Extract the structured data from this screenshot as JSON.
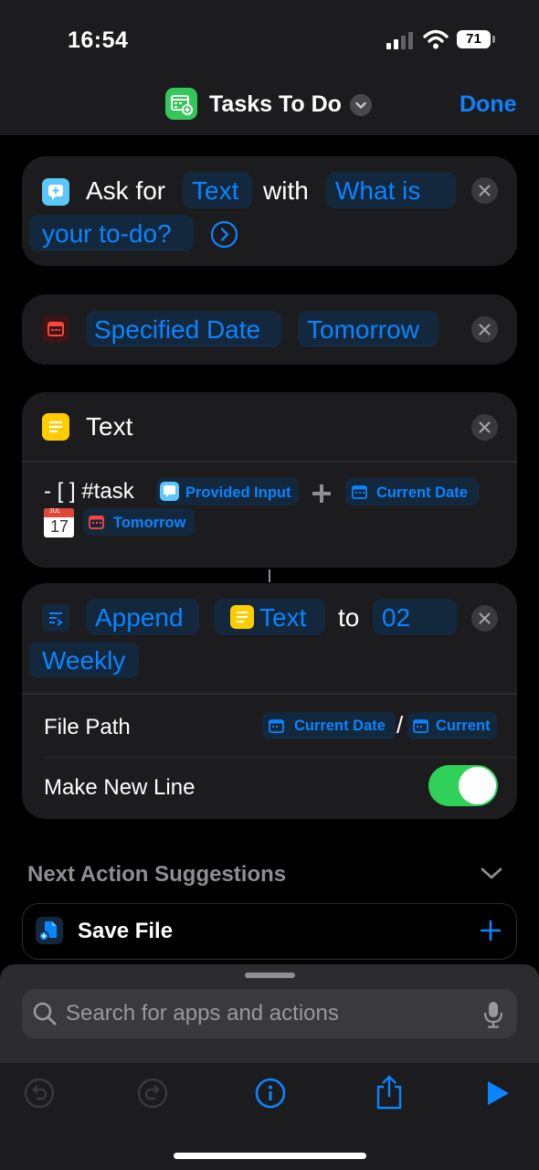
{
  "status_bar": {
    "time": "16:54",
    "battery": "71"
  },
  "header": {
    "title": "Tasks To Do",
    "done_label": "Done"
  },
  "ask_action": {
    "ask_for": "Ask for",
    "input_type": "Text",
    "with": "with",
    "prompt_line1": "What is",
    "prompt_line2": "your to-do?"
  },
  "date_action": {
    "type": "Specified Date",
    "value": "Tomorrow"
  },
  "text_action": {
    "title": "Text",
    "prefix": "- [ ] #task",
    "token_provided_input": "Provided Input",
    "token_current_date": "Current Date",
    "calendar_month": "JUL",
    "calendar_day": "17",
    "token_tomorrow": "Tomorrow"
  },
  "append_action": {
    "verb": "Append",
    "text_token": "Text",
    "to": "to",
    "target_line1": "02",
    "target_line2": "Weekly",
    "file_path_label": "File Path",
    "file_path_token1": "Current Date",
    "file_path_separator": "/",
    "file_path_token2": "Current",
    "make_new_line_label": "Make New Line",
    "make_new_line_on": true
  },
  "suggestions": {
    "title": "Next Action Suggestions",
    "items": [
      {
        "label": "Save File"
      }
    ]
  },
  "search": {
    "placeholder": "Search for apps and actions"
  },
  "colors": {
    "accent": "#0a84ff",
    "toggle_on": "#30d158",
    "card_bg": "#1c1c1e",
    "text_icon": "#ffcc00",
    "ask_icon": "#5ac8fa",
    "date_icon": "#ff453a"
  }
}
